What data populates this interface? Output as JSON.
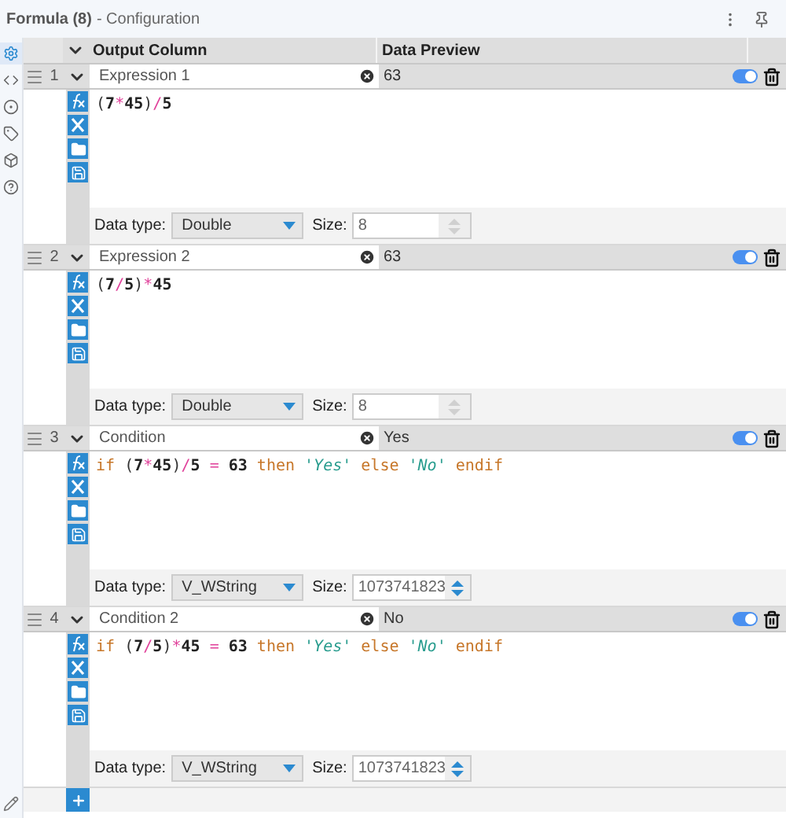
{
  "panel": {
    "title": "Formula (8)",
    "subtitle": "- Configuration"
  },
  "rail": [
    {
      "kind": "gear",
      "selected": true
    },
    {
      "kind": "code",
      "selected": false
    },
    {
      "kind": "target",
      "selected": false
    },
    {
      "kind": "tag",
      "selected": false
    },
    {
      "kind": "cube",
      "selected": false
    },
    {
      "kind": "help",
      "selected": false
    }
  ],
  "columns": [
    "Output Column",
    "Data Preview"
  ],
  "rows": [
    {
      "number": "1",
      "field": "Expression 1",
      "preview": "63",
      "on": true,
      "expanded": true,
      "expression": [
        {
          "kind": "paren",
          "text": "("
        },
        {
          "kind": "number",
          "text": "7"
        },
        {
          "kind": "operator",
          "text": "*"
        },
        {
          "kind": "number",
          "text": "45"
        },
        {
          "kind": "paren",
          "text": ")"
        },
        {
          "kind": "operator",
          "text": "/"
        },
        {
          "kind": "number",
          "text": "5"
        }
      ],
      "type_label": "Data type:",
      "type": "Double",
      "size_label": "Size:",
      "size": "8",
      "size_enabled": false
    },
    {
      "number": "2",
      "field": "Expression 2",
      "preview": "63",
      "on": true,
      "expanded": true,
      "expression": [
        {
          "kind": "paren",
          "text": "("
        },
        {
          "kind": "number",
          "text": "7"
        },
        {
          "kind": "operator",
          "text": "/"
        },
        {
          "kind": "number",
          "text": "5"
        },
        {
          "kind": "paren",
          "text": ")"
        },
        {
          "kind": "operator",
          "text": "*"
        },
        {
          "kind": "number",
          "text": "45"
        }
      ],
      "type_label": "Data type:",
      "type": "Double",
      "size_label": "Size:",
      "size": "8",
      "size_enabled": false
    },
    {
      "number": "3",
      "field": "Condition",
      "preview": "Yes",
      "on": true,
      "expanded": true,
      "expression": [
        {
          "kind": "keyword",
          "text": "if"
        },
        {
          "kind": "paren",
          "text": "(",
          "gap": true
        },
        {
          "kind": "number",
          "text": "7"
        },
        {
          "kind": "operator",
          "text": "*"
        },
        {
          "kind": "number",
          "text": "45"
        },
        {
          "kind": "paren",
          "text": ")"
        },
        {
          "kind": "operator",
          "text": "/"
        },
        {
          "kind": "number",
          "text": "5"
        },
        {
          "kind": "operator",
          "text": "=",
          "gap": true
        },
        {
          "kind": "number",
          "text": "63",
          "gap": true
        },
        {
          "kind": "keyword",
          "text": "then",
          "gap": true
        },
        {
          "kind": "string",
          "text": "'Yes'",
          "gap": true
        },
        {
          "kind": "keyword",
          "text": "else",
          "gap": true
        },
        {
          "kind": "string",
          "text": "'No'",
          "gap": true
        },
        {
          "kind": "keyword",
          "text": "endif",
          "gap": true
        }
      ],
      "type_label": "Data type:",
      "type": "V_WString",
      "size_label": "Size:",
      "size": "1073741823",
      "size_enabled": true
    },
    {
      "number": "4",
      "field": "Condition 2",
      "preview": "No",
      "on": true,
      "expanded": true,
      "expression": [
        {
          "kind": "keyword",
          "text": "if"
        },
        {
          "kind": "paren",
          "text": "(",
          "gap": true
        },
        {
          "kind": "number",
          "text": "7"
        },
        {
          "kind": "operator",
          "text": "/"
        },
        {
          "kind": "number",
          "text": "5"
        },
        {
          "kind": "paren",
          "text": ")"
        },
        {
          "kind": "operator",
          "text": "*"
        },
        {
          "kind": "number",
          "text": "45"
        },
        {
          "kind": "operator",
          "text": "=",
          "gap": true
        },
        {
          "kind": "number",
          "text": "63",
          "gap": true
        },
        {
          "kind": "keyword",
          "text": "then",
          "gap": true
        },
        {
          "kind": "string",
          "text": "'Yes'",
          "gap": true
        },
        {
          "kind": "keyword",
          "text": "else",
          "gap": true
        },
        {
          "kind": "string",
          "text": "'No'",
          "gap": true
        },
        {
          "kind": "keyword",
          "text": "endif",
          "gap": true
        }
      ],
      "type_label": "Data type:",
      "type": "V_WString",
      "size_label": "Size:",
      "size": "1073741823",
      "size_enabled": true
    }
  ]
}
